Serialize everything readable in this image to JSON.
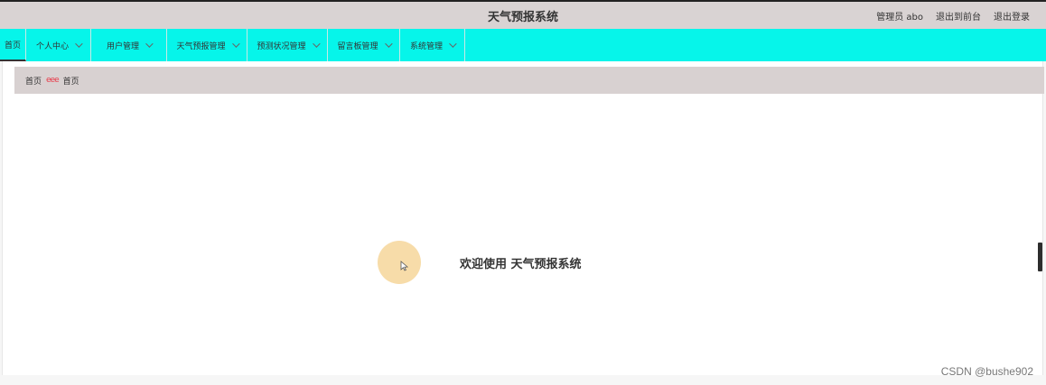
{
  "header": {
    "title": "天气预报系统",
    "admin_label": "管理员 abo",
    "back_to_front": "退出到前台",
    "logout": "退出登录"
  },
  "nav": {
    "items": [
      {
        "label": "首页",
        "has_dropdown": false,
        "active": true
      },
      {
        "label": "个人中心",
        "has_dropdown": true,
        "active": false
      },
      {
        "label": "用户管理",
        "has_dropdown": true,
        "active": false
      },
      {
        "label": "天气预报管理",
        "has_dropdown": true,
        "active": false
      },
      {
        "label": "预测状况管理",
        "has_dropdown": true,
        "active": false
      },
      {
        "label": "留言板管理",
        "has_dropdown": true,
        "active": false
      },
      {
        "label": "系统管理",
        "has_dropdown": true,
        "active": false
      }
    ]
  },
  "breadcrumb": {
    "home": "首页",
    "separator": "eee",
    "current": "首页"
  },
  "main": {
    "welcome": "欢迎使用 天气预报系统"
  },
  "watermark": "CSDN @bushe902",
  "colors": {
    "header_bg": "#d9d3d3",
    "nav_bg": "#06f5ea",
    "breadcrumb_bg": "#d8d1d1",
    "separator": "#e83b4a",
    "welcome_circle": "#f7dca9"
  },
  "icons": {
    "dropdown": "chevron-down-icon",
    "cursor": "mouse-cursor-icon"
  }
}
